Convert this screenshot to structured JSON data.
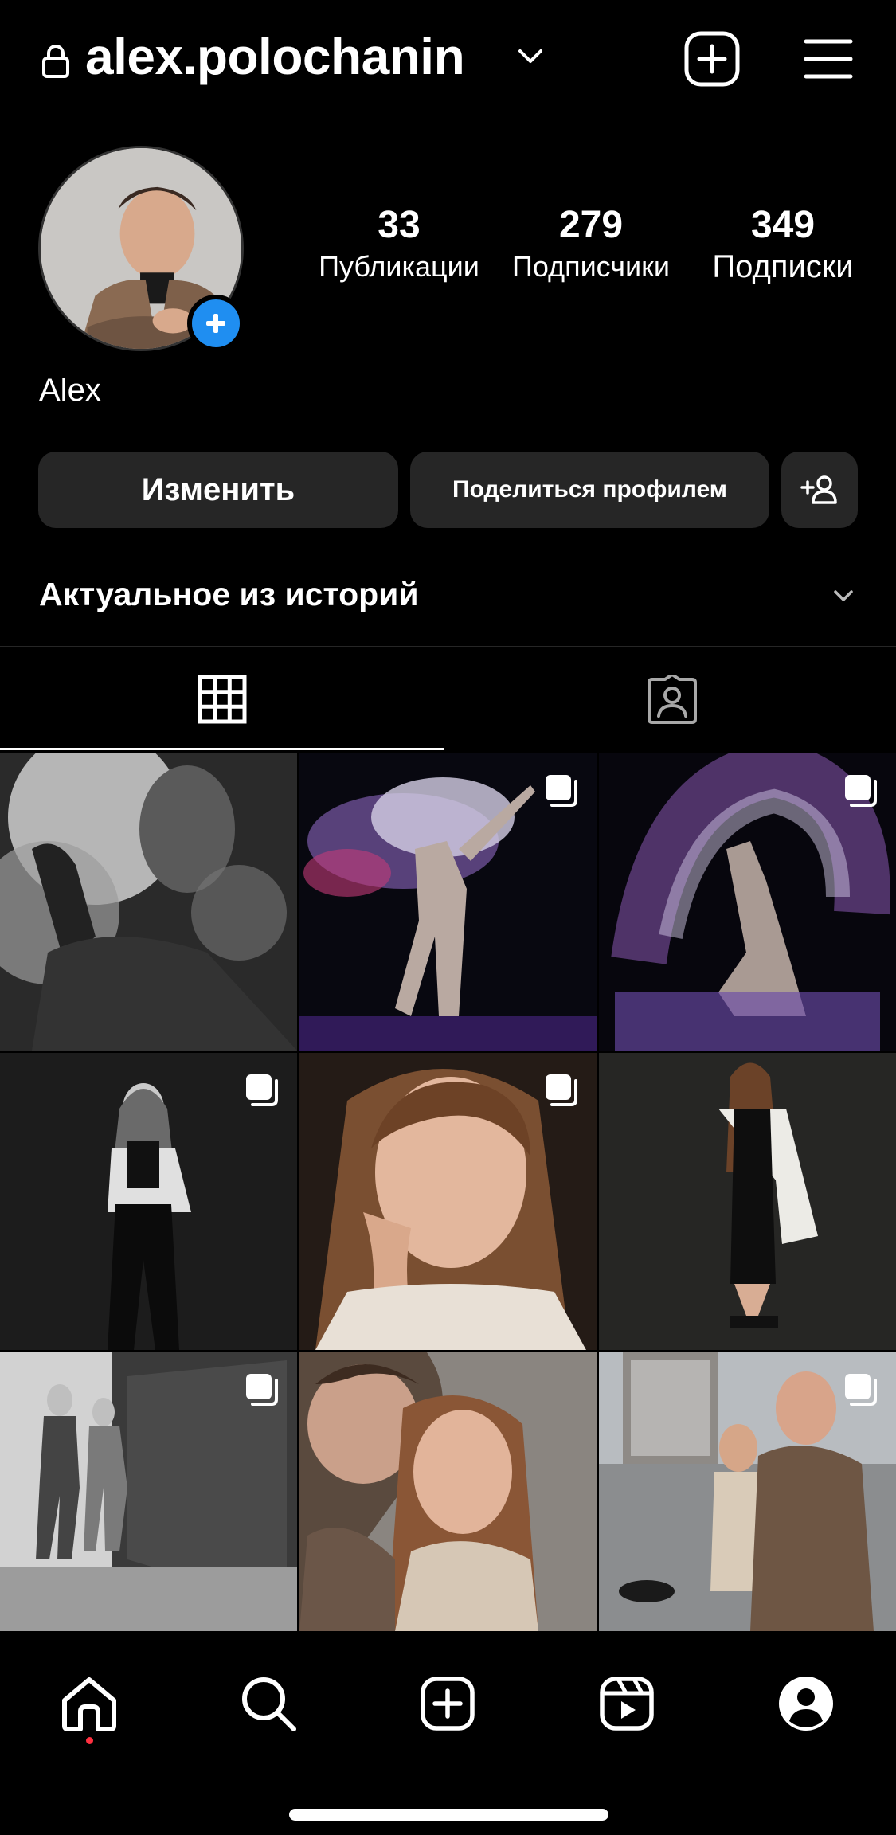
{
  "header": {
    "username": "alex.polochanin",
    "icons": [
      "lock-icon",
      "chevron-down-icon",
      "plus-square-icon",
      "menu-icon"
    ]
  },
  "profile": {
    "display_name": "Alex",
    "stats": {
      "posts": {
        "value": "33",
        "label": "Публикации"
      },
      "followers": {
        "value": "279",
        "label": "Подписчики"
      },
      "following": {
        "value": "349",
        "label": "Подписки"
      }
    }
  },
  "actions": {
    "edit_label": "Изменить",
    "share_label": "Поделиться профилем"
  },
  "highlights": {
    "title": "Актуальное из историй"
  },
  "tabs": [
    {
      "icon": "grid-icon",
      "active": true
    },
    {
      "icon": "tagged-person-icon",
      "active": false
    }
  ],
  "posts": [
    {
      "id": 1,
      "multi": false
    },
    {
      "id": 2,
      "multi": true
    },
    {
      "id": 3,
      "multi": true
    },
    {
      "id": 4,
      "multi": true
    },
    {
      "id": 5,
      "multi": true
    },
    {
      "id": 6,
      "multi": false
    },
    {
      "id": 7,
      "multi": true
    },
    {
      "id": 8,
      "multi": false
    },
    {
      "id": 9,
      "multi": true
    }
  ],
  "bottom_nav": [
    {
      "icon": "home-icon",
      "active": true
    },
    {
      "icon": "search-icon",
      "active": false
    },
    {
      "icon": "create-icon",
      "active": false
    },
    {
      "icon": "reels-icon",
      "active": false
    },
    {
      "icon": "profile-icon",
      "active": false
    }
  ],
  "colors": {
    "background": "#000000",
    "button_bg": "#262626",
    "accent_blue": "#1f8ef1",
    "notification_dot": "#ff3040"
  }
}
